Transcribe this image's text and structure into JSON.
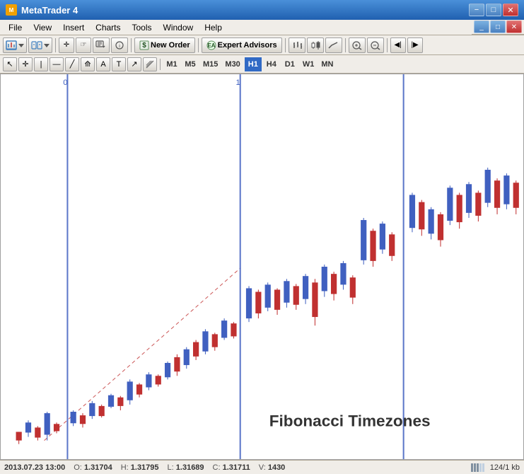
{
  "titleBar": {
    "icon": "MT",
    "title": "MetaTrader 4",
    "minimize": "−",
    "maximize": "□",
    "close": "✕",
    "innerMinimize": "_",
    "innerMaximize": "□",
    "innerClose": "✕"
  },
  "menuBar": {
    "items": [
      "File",
      "View",
      "Insert",
      "Charts",
      "Tools",
      "Window",
      "Help"
    ]
  },
  "toolbar1": {
    "newOrder": "New Order",
    "expertAdvisors": "Expert Advisors"
  },
  "toolbar2": {
    "timeframes": [
      "M1",
      "M5",
      "M15",
      "M30",
      "H1",
      "H4",
      "D1",
      "W1",
      "MN"
    ],
    "activeTimeframe": "H1"
  },
  "chart": {
    "label": "Fibonacci Timezones",
    "vertLines": [
      0,
      1
    ],
    "fibNumbers": [
      "0",
      "1"
    ]
  },
  "statusBar": {
    "datetime": "2013.07.23 13:00",
    "open": {
      "label": "O:",
      "value": "1.31704"
    },
    "high": {
      "label": "H:",
      "value": "1.31795"
    },
    "low": {
      "label": "L:",
      "value": "1.31689"
    },
    "close": {
      "label": "C:",
      "value": "1.31711"
    },
    "volume": {
      "label": "V:",
      "value": "1430"
    },
    "fileInfo": "124/1 kb"
  }
}
